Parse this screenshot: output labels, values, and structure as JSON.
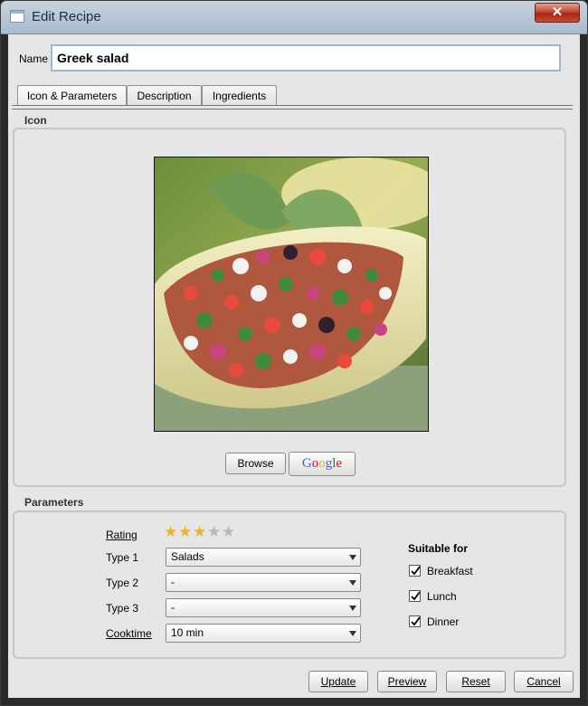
{
  "window": {
    "title": "Edit Recipe",
    "close_symbol": "✕"
  },
  "name": {
    "label": "Name",
    "value": "Greek salad"
  },
  "tabs": [
    {
      "label": "Icon & Parameters",
      "active": true
    },
    {
      "label": "Description",
      "active": false
    },
    {
      "label": "Ingredients",
      "active": false
    }
  ],
  "icon_section": {
    "title": "Icon",
    "browse_label": "Browse",
    "google_label": "Google"
  },
  "parameters": {
    "title": "Parameters",
    "rating_label": "Rating",
    "rating_value": 3,
    "rating_max": 5,
    "type1_label": "Type 1",
    "type1_value": "Salads",
    "type2_label": "Type 2",
    "type2_value": "-",
    "type3_label": "Type 3",
    "type3_value": "-",
    "cooktime_label": "Cooktime",
    "cooktime_value": "10 min",
    "suitable_title": "Suitable for",
    "suitable": [
      {
        "label": "Breakfast",
        "checked": true
      },
      {
        "label": "Lunch",
        "checked": true
      },
      {
        "label": "Dinner",
        "checked": true
      }
    ]
  },
  "footer": {
    "update_label": "Update",
    "preview_label": "Preview",
    "reset_label": "Reset",
    "cancel_label": "Cancel"
  },
  "colors": {
    "star_on": "#f2b21f",
    "star_off": "#b8b8b8",
    "google_blue": "#3369e8",
    "google_red": "#d50f25",
    "google_yellow": "#eeb211",
    "google_green": "#009925"
  }
}
